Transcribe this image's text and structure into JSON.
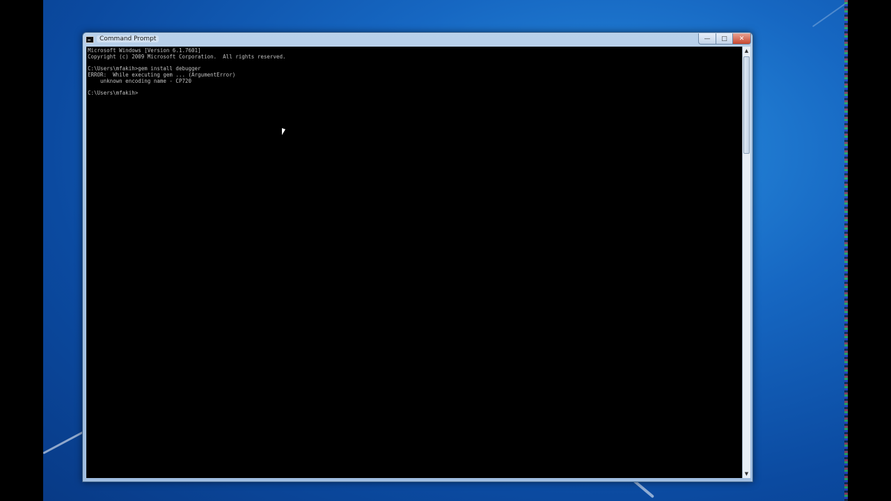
{
  "window": {
    "title": "Command Prompt",
    "minimize_glyph": "—",
    "maximize_glyph": "□",
    "close_glyph": "✕"
  },
  "console": {
    "text": "Microsoft Windows [Version 6.1.7601]\nCopyright (c) 2009 Microsoft Corporation.  All rights reserved.\n\nC:\\Users\\mfakih>gem install debugger\nERROR:  While executing gem ... (ArgumentError)\n    unknown encoding name - CP720\n\nC:\\Users\\mfakih>"
  },
  "scrollbar": {
    "up_glyph": "▲",
    "down_glyph": "▼"
  },
  "icons": {
    "app": "cmd-icon",
    "cursor": "mouse-pointer-icon"
  }
}
